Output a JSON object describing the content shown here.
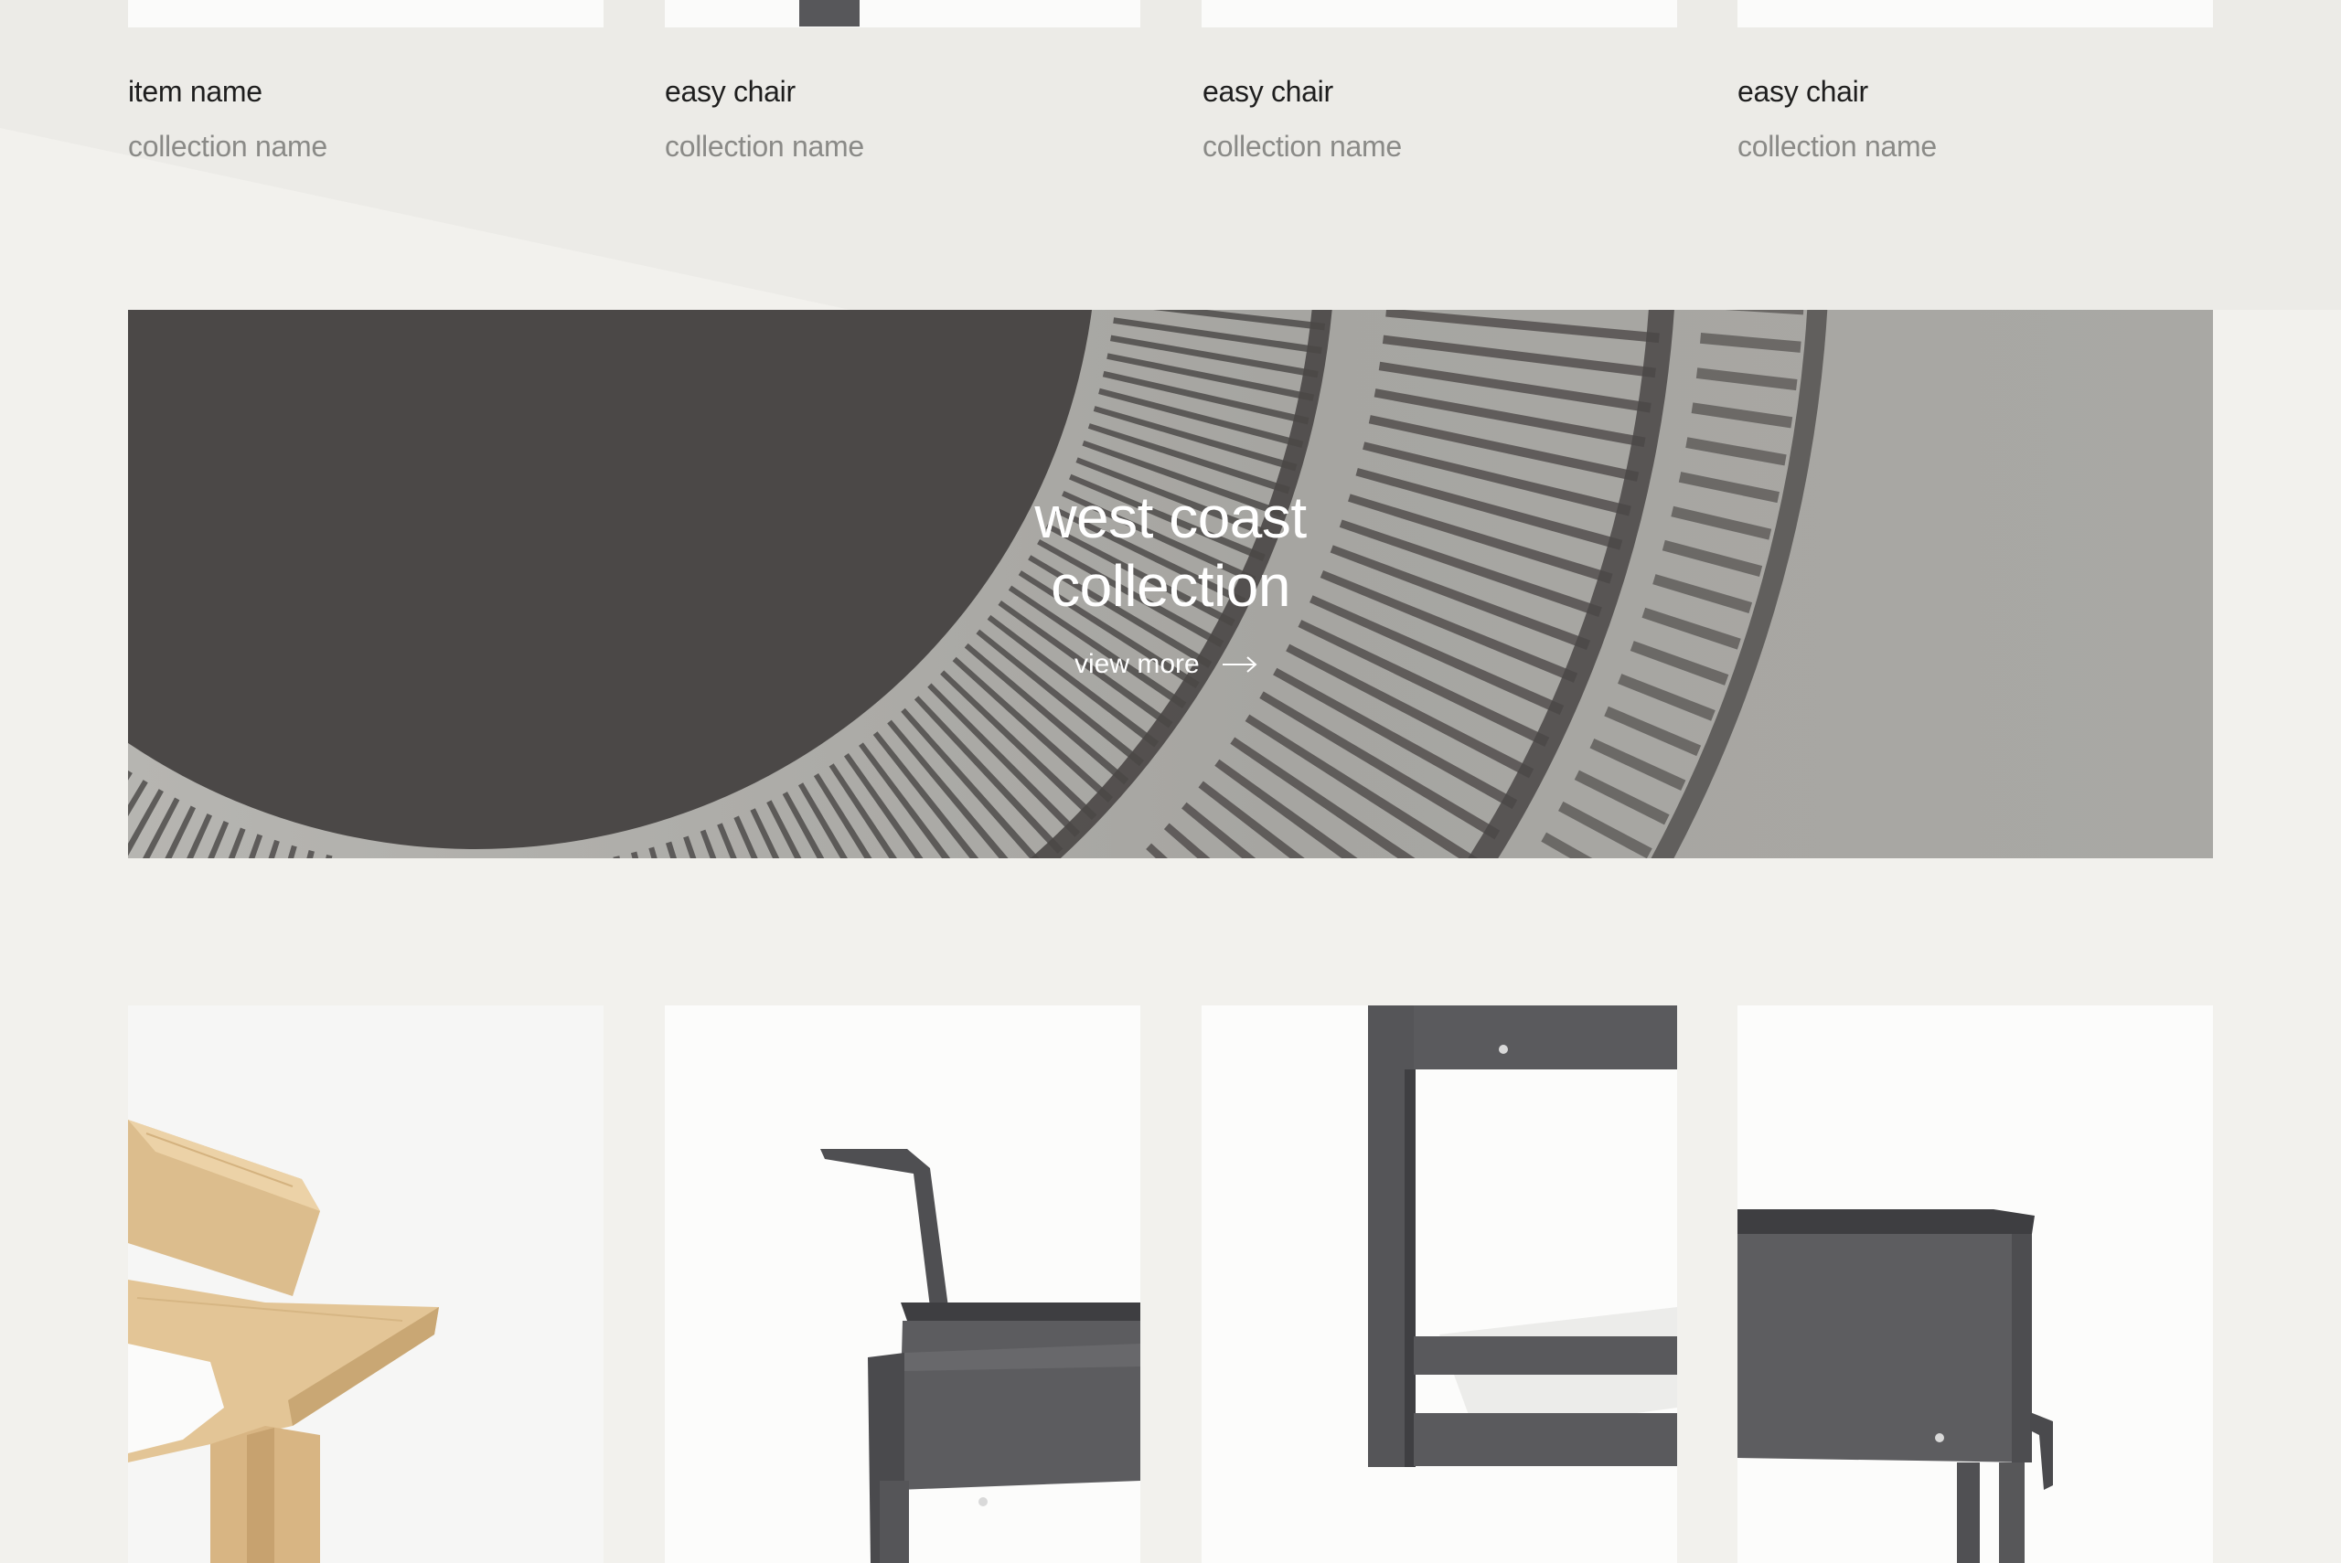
{
  "top_row": {
    "items": [
      {
        "name": "item name",
        "collection": "collection name"
      },
      {
        "name": "easy chair",
        "collection": "collection name"
      },
      {
        "name": "easy chair",
        "collection": "collection name"
      },
      {
        "name": "easy chair",
        "collection": "collection name"
      }
    ]
  },
  "banner": {
    "title_line1": "west coast",
    "title_line2": "collection",
    "link_label": "view more",
    "link_icon": "arrow-right-icon"
  },
  "bottom_row": {
    "images": [
      {
        "icon": "wooden-chair-image"
      },
      {
        "icon": "metal-easy-chair-image"
      },
      {
        "icon": "metal-chair-frame-image"
      },
      {
        "icon": "metal-chair-seat-image"
      }
    ]
  },
  "colors": {
    "page_background": "#f2f1ed",
    "banner_background": "#a9a8a4",
    "item_name_text": "#1e1e1e",
    "collection_text": "#8a8a87",
    "metal_chair": "#57575a",
    "wood": "#e3c596"
  }
}
